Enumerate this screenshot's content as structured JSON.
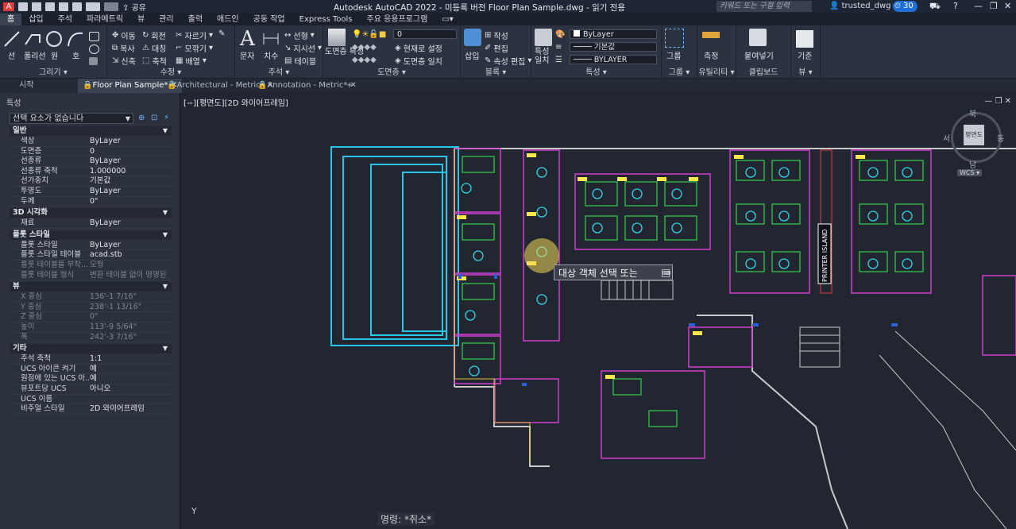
{
  "titlebar": {
    "app_icon": "A",
    "title": "Autodesk AutoCAD 2022 - 미등록 버전    Floor Plan Sample.dwg - 읽기 전용",
    "share_label": "공유",
    "search_placeholder": "키워드 또는 구절 입력",
    "user": "trusted_dwg",
    "badge_count": "30"
  },
  "ribbon_tabs": [
    "홈",
    "삽입",
    "주석",
    "파라메트릭",
    "뷰",
    "관리",
    "출력",
    "애드인",
    "공동 작업",
    "Express Tools",
    "주요 응용프로그램"
  ],
  "ribbon": {
    "draw": {
      "title": "그리기",
      "line": "선",
      "polyline": "폴리선",
      "circle": "원",
      "arc": "호"
    },
    "modify": {
      "title": "수정",
      "move": "이동",
      "rotate": "회전",
      "trim": "자르기",
      "copy": "복사",
      "mirror": "대칭",
      "fillet": "모깎기",
      "stretch": "신축",
      "scale": "축척",
      "array": "배열"
    },
    "annotation": {
      "title": "주석",
      "text": "문자",
      "dimension": "치수",
      "leader": "지시선",
      "table": "테이블",
      "linear": "선형"
    },
    "layers": {
      "title": "도면층",
      "props": "도면층 특성",
      "layer_value": "0",
      "make_current": "현재로 설정",
      "match": "도면층 일치"
    },
    "block": {
      "title": "블록",
      "insert": "삽입",
      "create": "작성",
      "edit": "편집",
      "edit_attr": "속성 편집"
    },
    "properties": {
      "title": "특성",
      "match": "특성 일치",
      "color": "ByLayer",
      "linetype": "기본값",
      "lineweight": "BYLAYER"
    },
    "groups": {
      "title": "그룹",
      "group": "그룹"
    },
    "utilities": {
      "title": "유틸리티",
      "measure": "측정"
    },
    "clipboard": {
      "title": "클립보드",
      "paste": "붙여넣기"
    },
    "view": {
      "title": "뷰",
      "base": "기준"
    }
  },
  "doc_tabs": [
    "시작",
    "Floor Plan Sample*",
    "Architectural - Metric*",
    "Annotation - Metric*"
  ],
  "props": {
    "title": "특성",
    "selection": "선택 요소가 없습니다",
    "sections": [
      {
        "name": "일반",
        "rows": [
          {
            "k": "색상",
            "v": "ByLayer"
          },
          {
            "k": "도면층",
            "v": "0"
          },
          {
            "k": "선종류",
            "v": "ByLayer"
          },
          {
            "k": "선종류 축척",
            "v": "1.000000"
          },
          {
            "k": "선가중치",
            "v": "기본값"
          },
          {
            "k": "투명도",
            "v": "ByLayer"
          },
          {
            "k": "두께",
            "v": "0\""
          }
        ]
      },
      {
        "name": "3D 시각화",
        "rows": [
          {
            "k": "재료",
            "v": "ByLayer"
          }
        ]
      },
      {
        "name": "플롯 스타일",
        "rows": [
          {
            "k": "플롯 스타일",
            "v": "ByLayer"
          },
          {
            "k": "플롯 스타일 테이블",
            "v": "acad.stb"
          },
          {
            "k": "플롯 테이블을 부착...",
            "v": "모형",
            "dim": true
          },
          {
            "k": "플롯 테이블 형식",
            "v": "변환 테이블 없이 명명된",
            "dim": true
          }
        ]
      },
      {
        "name": "뷰",
        "rows": [
          {
            "k": "X 중심",
            "v": "136'-1 7/16\"",
            "dim": true
          },
          {
            "k": "Y 중심",
            "v": "238'-1 13/16\"",
            "dim": true
          },
          {
            "k": "Z 중심",
            "v": "0\"",
            "dim": true
          },
          {
            "k": "높이",
            "v": "113'-9 5/64\"",
            "dim": true
          },
          {
            "k": "폭",
            "v": "242'-3 7/16\"",
            "dim": true
          }
        ]
      },
      {
        "name": "기타",
        "rows": [
          {
            "k": "주석 축척",
            "v": "1:1"
          },
          {
            "k": "UCS 아이콘 켜기",
            "v": "예"
          },
          {
            "k": "원점에 있는 UCS 아...",
            "v": "예"
          },
          {
            "k": "뷰포트당 UCS",
            "v": "아니오"
          },
          {
            "k": "UCS 이름",
            "v": ""
          },
          {
            "k": "비주얼 스타일",
            "v": "2D 와이어프레임"
          }
        ]
      }
    ]
  },
  "canvas": {
    "view_label": "[−][평면도][2D 와이어프레임]",
    "tooltip": "대상 객체 선택 또는",
    "command_line": "명령: *취소*",
    "printer_label": "PRINTER ISLAND",
    "ucs_label": "WCS",
    "y_axis": "Y",
    "compass": {
      "north": "북",
      "south": "남",
      "east": "동",
      "west": "서",
      "top": "평면도"
    }
  }
}
